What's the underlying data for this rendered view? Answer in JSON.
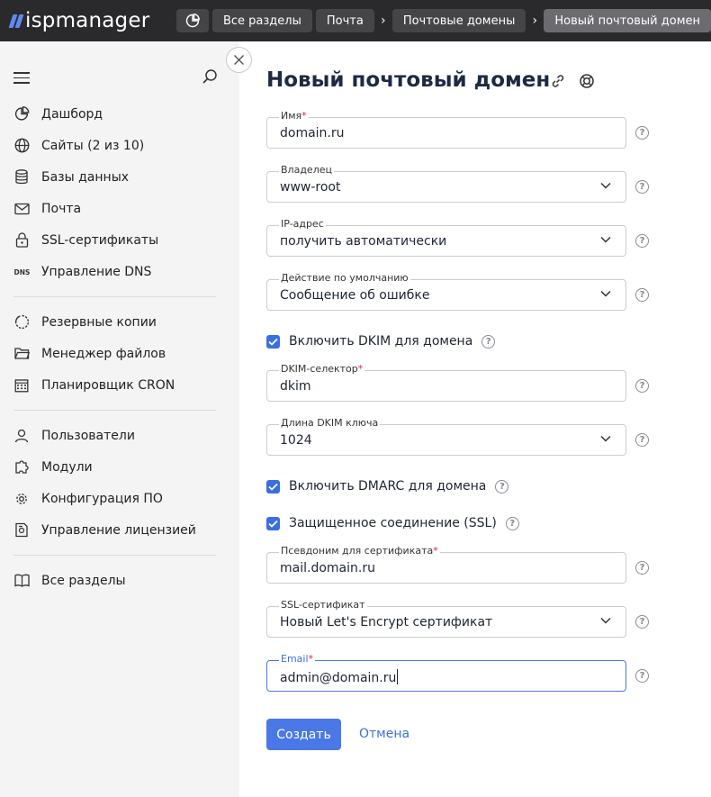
{
  "header": {
    "logo_text": "ispmanager",
    "breadcrumbs": [
      "Все разделы",
      "Почта",
      "Почтовые домены",
      "Новый почтовый домен"
    ]
  },
  "sidebar": {
    "groups": [
      [
        {
          "label": "Дашборд",
          "icon": "dashboard-icon"
        },
        {
          "label": "Сайты (2 из 10)",
          "icon": "globe-icon"
        },
        {
          "label": "Базы данных",
          "icon": "database-icon"
        },
        {
          "label": "Почта",
          "icon": "mail-icon"
        },
        {
          "label": "SSL-сертификаты",
          "icon": "lock-icon"
        },
        {
          "label": "Управление DNS",
          "icon": "dns-icon"
        }
      ],
      [
        {
          "label": "Резервные копии",
          "icon": "backup-icon"
        },
        {
          "label": "Менеджер файлов",
          "icon": "folder-icon"
        },
        {
          "label": "Планировщик CRON",
          "icon": "calendar-icon"
        }
      ],
      [
        {
          "label": "Пользователи",
          "icon": "user-icon"
        },
        {
          "label": "Модули",
          "icon": "puzzle-icon"
        },
        {
          "label": "Конфигурация ПО",
          "icon": "gear-icon"
        },
        {
          "label": "Управление лицензией",
          "icon": "license-icon"
        }
      ],
      [
        {
          "label": "Все разделы",
          "icon": "book-icon"
        }
      ]
    ]
  },
  "form": {
    "title": "Новый почтовый домен",
    "name": {
      "label": "Имя",
      "required": "*",
      "value": "domain.ru"
    },
    "owner": {
      "label": "Владелец",
      "value": "www-root"
    },
    "ip": {
      "label": "IP-адрес",
      "value": "получить автоматически"
    },
    "default_action": {
      "label": "Действие по умолчанию",
      "value": "Сообщение об ошибке"
    },
    "dkim_enable": {
      "label": "Включить DKIM для домена",
      "checked": true
    },
    "dkim_selector": {
      "label": "DKIM-селектор",
      "required": "*",
      "value": "dkim"
    },
    "dkim_length": {
      "label": "Длина DKIM ключа",
      "value": "1024"
    },
    "dmarc_enable": {
      "label": "Включить DMARC для домена",
      "checked": true
    },
    "ssl_enable": {
      "label": "Защищенное соединение (SSL)",
      "checked": true
    },
    "cert_alias": {
      "label": "Псевдоним для сертификата",
      "required": "*",
      "value": "mail.domain.ru"
    },
    "ssl_cert": {
      "label": "SSL-сертификат",
      "value": "Новый Let's Encrypt сертификат"
    },
    "email": {
      "label": "Email",
      "required": "*",
      "value": "admin@domain.ru"
    },
    "help_glyph": "?",
    "submit_label": "Создать",
    "cancel_label": "Отмена"
  },
  "colors": {
    "accent": "#4a78e6",
    "topbar": "#2a2a2c",
    "sidebar": "#f4f4f5",
    "required": "#e2223a"
  }
}
